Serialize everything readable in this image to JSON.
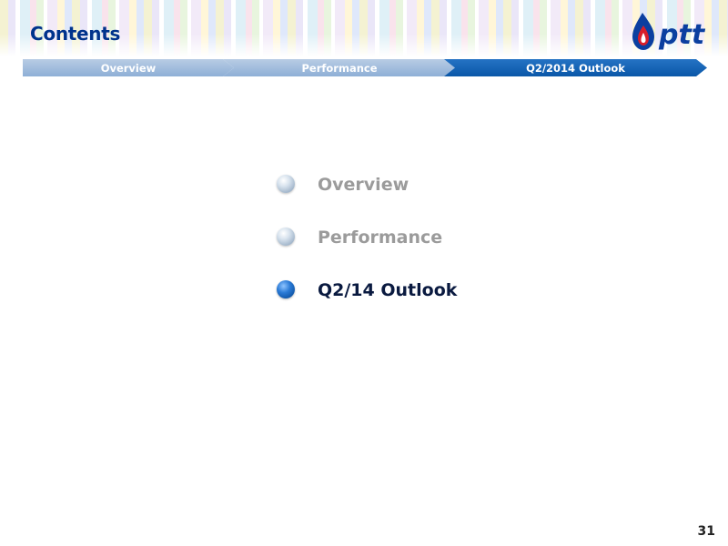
{
  "header": {
    "title": "Contents",
    "logo_text": "ptt"
  },
  "nav": {
    "segments": [
      {
        "label": "Overview",
        "active": false
      },
      {
        "label": "Performance",
        "active": false
      },
      {
        "label": "Q2/2014 Outlook",
        "active": true
      }
    ]
  },
  "agenda": {
    "items": [
      {
        "label": "Overview",
        "active": false
      },
      {
        "label": "Performance",
        "active": false
      },
      {
        "label": "Q2/14 Outlook",
        "active": true
      }
    ]
  },
  "footer": {
    "page_number": "31"
  },
  "colors": {
    "title": "#00338c",
    "nav_inactive": "#a3bde0",
    "nav_active": "#1565bd",
    "agenda_inactive": "#9b9b9b",
    "agenda_active": "#0a1a40",
    "logo_blue": "#0b3fa0",
    "logo_red": "#d81e2a"
  },
  "icons": {
    "logo": "ptt-flame-logo",
    "bullet": "sphere-bullet-icon"
  }
}
